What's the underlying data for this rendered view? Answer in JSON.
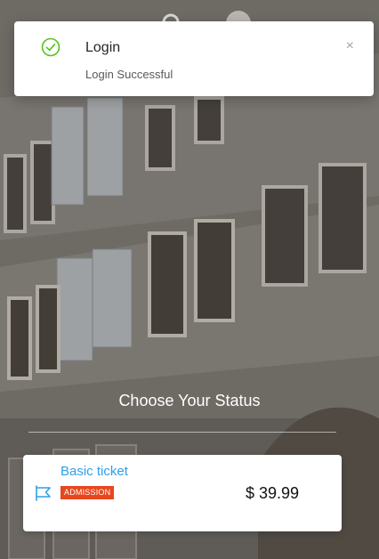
{
  "notification": {
    "title": "Login",
    "message": "Login Successful",
    "close_symbol": "×",
    "icon": "check-circle-icon",
    "accent_color": "#52c41a"
  },
  "status": {
    "title": "Choose Your Status"
  },
  "tickets": [
    {
      "name": "Basic ticket",
      "badge": "ADMISSION",
      "price": "$ 39.99",
      "icon": "flag-icon",
      "name_color": "#2f9fe8",
      "badge_color": "#e8471d"
    }
  ]
}
